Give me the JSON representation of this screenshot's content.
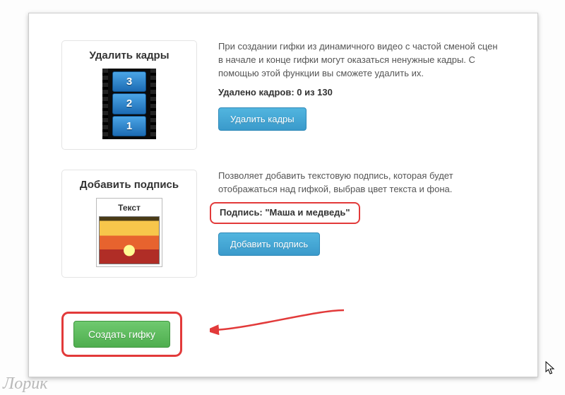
{
  "sections": {
    "delete": {
      "title": "Удалить кадры",
      "frames": [
        "3",
        "2",
        "1"
      ],
      "description": "При создании гифки из динамичного видео с частой сменой сцен в начале и конце гифки могут оказаться ненужные кадры. С помощью этой функции вы сможете удалить их.",
      "status": "Удалено кадров: 0 из 130",
      "button": "Удалить кадры"
    },
    "caption": {
      "title": "Добавить подпись",
      "thumb_label": "Текст",
      "description": "Позволяет добавить текстовую подпись, которая будет отображаться над гифкой, выбрав цвет текста и фона.",
      "status": "Подпись: \"Маша и медведь\"",
      "button": "Добавить подпись"
    }
  },
  "submit": {
    "button": "Создать гифку"
  },
  "watermark": "Лорик"
}
